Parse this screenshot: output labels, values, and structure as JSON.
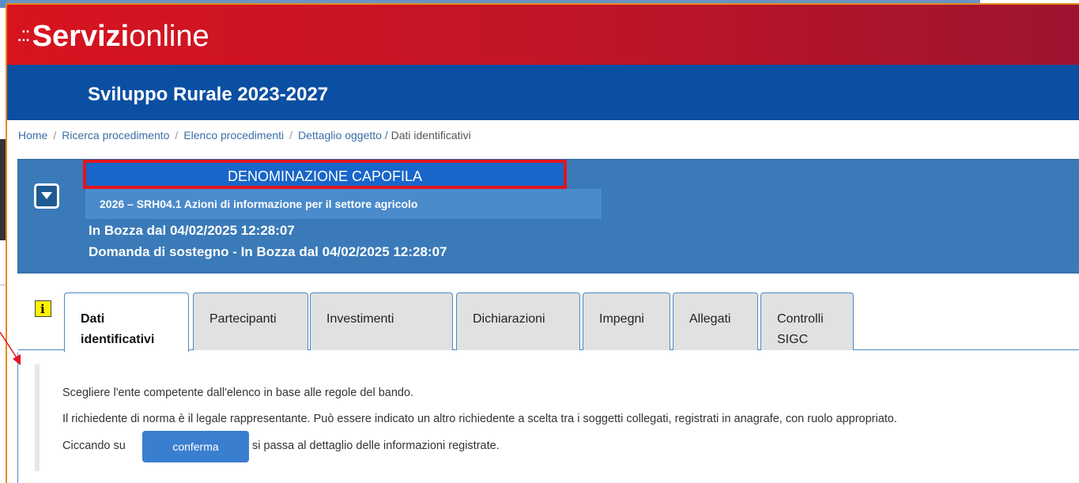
{
  "app": {
    "logo_dots": ".::",
    "logo_bold": "Servizi",
    "logo_light": "online",
    "section_title": "Sviluppo Rurale 2023-2027"
  },
  "breadcrumb": {
    "items": [
      "Home",
      "Ricerca procedimento",
      "Elenco procedimenti",
      "Dettaglio oggetto"
    ],
    "separator": "/",
    "current": "Dati identificativi"
  },
  "panel": {
    "denominazione": "DENOMINAZIONE CAPOFILA",
    "procedimento": "2026 – SRH04.1 Azioni di informazione per il settore agricolo",
    "stato": "In Bozza dal 04/02/2025 12:28:07",
    "domanda": "Domanda di sostegno - In Bozza dal 04/02/2025 12:28:07"
  },
  "info_icon_label": "i",
  "tabs": [
    {
      "label_line1": "Dati",
      "label_line2": "identificativi",
      "active": true
    },
    {
      "label_line1": "Partecipanti",
      "label_line2": ""
    },
    {
      "label_line1": "Investimenti",
      "label_line2": ""
    },
    {
      "label_line1": "Dichiarazioni",
      "label_line2": ""
    },
    {
      "label_line1": "Impegni",
      "label_line2": ""
    },
    {
      "label_line1": "Allegati",
      "label_line2": ""
    },
    {
      "label_line1": "Controlli",
      "label_line2": "SIGC"
    }
  ],
  "notes": {
    "line1": "Scegliere l'ente competente dall'elenco in base alle regole del bando.",
    "line2": "Il richiedente di norma è il legale rappresentante. Può essere indicato un altro richiedente a scelta tra i soggetti collegati, registrati in anagrafe, con ruolo appropriato.",
    "line3_before": "Ciccando su",
    "confirm_label": "conferma",
    "line3_after": "si passa al dettaglio delle informazioni registrate."
  },
  "colors": {
    "header_red": "#d7141f",
    "header_blue": "#0b4fa3",
    "panel_blue": "#3a7ab8",
    "highlight_red": "#e2141f",
    "accent_orange": "#e8891e",
    "button_blue": "#3a7ed0"
  }
}
